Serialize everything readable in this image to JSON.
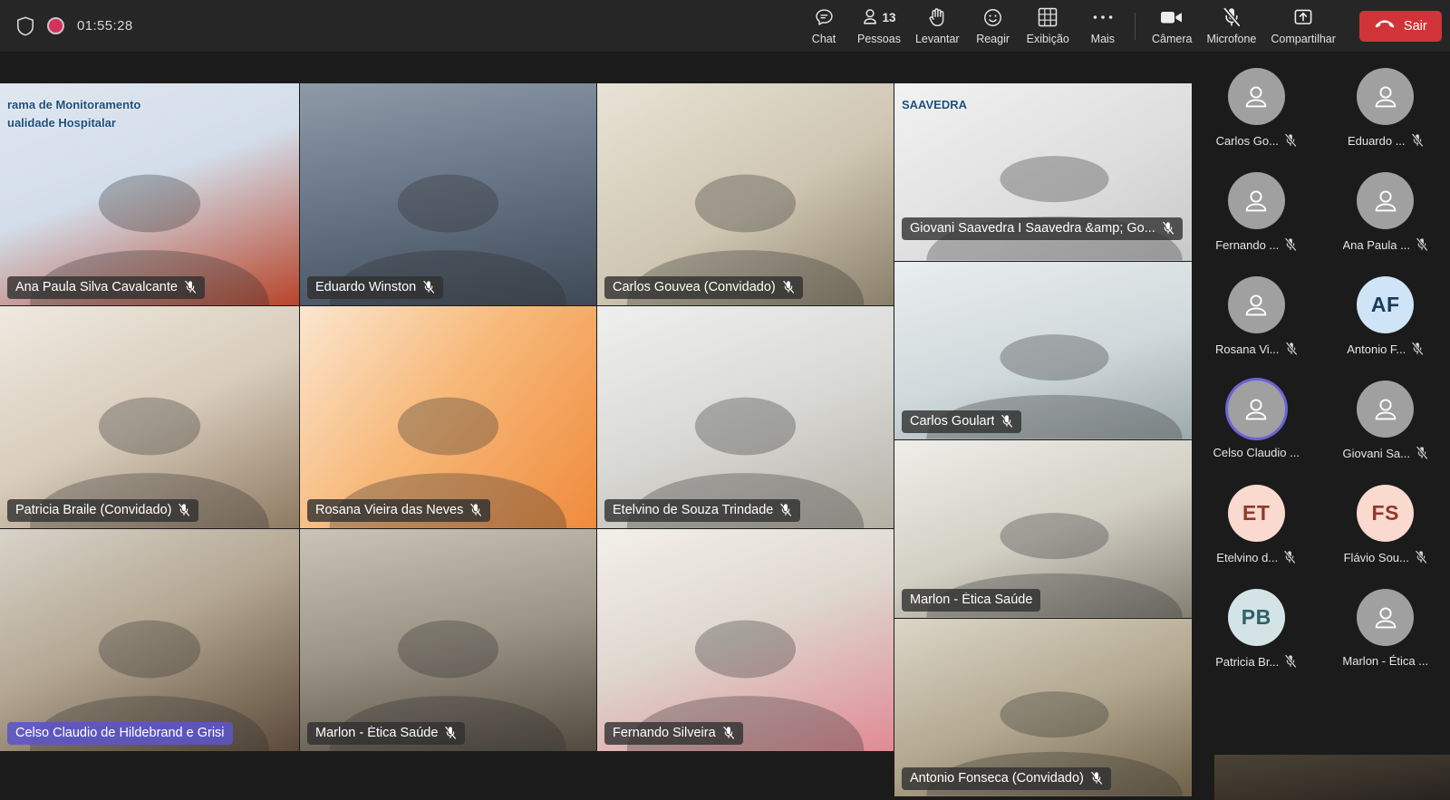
{
  "topbar": {
    "shield_icon": "shield-icon",
    "recording_icon": "record-dot-icon",
    "elapsed_time": "01:55:28",
    "buttons": [
      {
        "id": "chat",
        "label": "Chat",
        "icon": "chat-bubble-icon",
        "badge": ""
      },
      {
        "id": "people",
        "label": "Pessoas",
        "icon": "person-icon",
        "badge": "13"
      },
      {
        "id": "raise-hand",
        "label": "Levantar",
        "icon": "raised-hand-icon",
        "badge": ""
      },
      {
        "id": "react",
        "label": "Reagir",
        "icon": "smiley-icon",
        "badge": ""
      },
      {
        "id": "view",
        "label": "Exibição",
        "icon": "grid-icon",
        "badge": ""
      },
      {
        "id": "more",
        "label": "Mais",
        "icon": "ellipsis-icon",
        "badge": ""
      }
    ],
    "device_buttons": [
      {
        "id": "camera",
        "label": "Câmera",
        "icon": "camera-icon",
        "muted": false
      },
      {
        "id": "mic",
        "label": "Microfone",
        "icon": "microphone-off-icon",
        "muted": true
      },
      {
        "id": "share",
        "label": "Compartilhar",
        "icon": "share-up-arrow-icon",
        "muted": false
      }
    ],
    "leave_button": {
      "label": "Sair",
      "icon": "hangup-phone-icon",
      "color": "#d13438"
    }
  },
  "stage": {
    "tiles": [
      {
        "name": "Ana Paula Silva Cavalcante",
        "muted": true,
        "active": false,
        "tag_pos": "bottom",
        "bg": "linear-gradient(160deg,#dfe7f0 0%,#d3dde9 45%,#b8442a 100%)",
        "overlay_text": [
          "rama de Monitoramento",
          "ualidade Hospitalar"
        ]
      },
      {
        "name": "Eduardo Winston",
        "muted": true,
        "active": false,
        "tag_pos": "bottom",
        "bg": "linear-gradient(170deg,#8e9aa6 0%,#6d7b8c 40%,#3f4a57 100%)",
        "overlay_text": []
      },
      {
        "name": "Carlos Gouvea   (Convidado)",
        "muted": true,
        "active": false,
        "tag_pos": "bottom",
        "bg": "linear-gradient(150deg,#e8e3d6 0%,#cfc6b2 55%,#8a7f6a 100%)",
        "overlay_text": []
      },
      {
        "name": "Giovani Saavedra I Saavedra &amp; Go...",
        "muted": true,
        "active": false,
        "tag_pos": "top",
        "bg": "linear-gradient(150deg,#f2f2f2 0%,#dcdcdc 60%,#c6c6c6 100%)",
        "overlay_text": [
          "SAAVEDRA"
        ]
      },
      {
        "name": "Patricia Braile (Convidado)",
        "muted": true,
        "active": false,
        "tag_pos": "bottom",
        "bg": "linear-gradient(155deg,#efe9e0 0%,#d8ccbb 50%,#8e7a62 100%)",
        "overlay_text": []
      },
      {
        "name": "Rosana Vieira das Neves",
        "muted": true,
        "active": false,
        "tag_pos": "bottom",
        "bg": "linear-gradient(130deg,#fbe6cf 0%,#f7b97a 45%,#ef8b3c 100%)",
        "overlay_text": []
      },
      {
        "name": "Etelvino de Souza Trindade",
        "muted": true,
        "active": false,
        "tag_pos": "bottom",
        "bg": "linear-gradient(160deg,#efefef 0%,#d9d9d6 50%,#b4b0a4 100%)",
        "overlay_text": []
      },
      {
        "name": "Carlos Goulart",
        "muted": true,
        "active": false,
        "tag_pos": "bottom",
        "bg": "linear-gradient(165deg,#e9eef0 0%,#cfd8da 55%,#9aa6a8 100%)",
        "overlay_text": []
      },
      {
        "name": "Celso Claudio de Hildebrand e Grisi",
        "muted": false,
        "active": true,
        "tag_pos": "bottom",
        "bg": "linear-gradient(155deg,#d8d3c9 0%,#b5a894 45%,#5b4a39 100%)",
        "overlay_text": []
      },
      {
        "name": "Marlon - Ética Saúde",
        "muted": false,
        "active": false,
        "tag_pos": "bottom",
        "bg": "linear-gradient(160deg,#efeee8 0%,#d2cfc4 50%,#7e7a6e 100%)",
        "overlay_text": []
      },
      {
        "name": "Fernando Silveira",
        "muted": true,
        "active": false,
        "tag_pos": "bottom",
        "bg": "linear-gradient(160deg,#f3f0ea 0%,#ded8cf 45%,#e08a95 100%)",
        "overlay_text": []
      },
      {
        "name": "Marlon - Ética Saúde",
        "muted": true,
        "active": false,
        "tag_pos": "bottom",
        "bg": "linear-gradient(170deg,#c9c4b6 0%,#9b9486 50%,#514a3e 100%)",
        "overlay_text": []
      },
      {
        "name": "Antonio Fonseca (Convidado)",
        "muted": true,
        "active": false,
        "tag_pos": "bottom",
        "bg": "linear-gradient(160deg,#dcd6c8 0%,#b3a890 50%,#6a5c45 100%)",
        "overlay_text": []
      }
    ]
  },
  "sidebar": {
    "collapse_icon": "chevron-up-icon",
    "participants": [
      {
        "name": "Carlos Go...",
        "initials": "",
        "avatar_bg": "#a0a0a0",
        "avatar_fg": "#ffffff",
        "muted": true,
        "active": false
      },
      {
        "name": "Eduardo ...",
        "initials": "",
        "avatar_bg": "#a0a0a0",
        "avatar_fg": "#ffffff",
        "muted": true,
        "active": false
      },
      {
        "name": "Fernando ...",
        "initials": "",
        "avatar_bg": "#a0a0a0",
        "avatar_fg": "#ffffff",
        "muted": true,
        "active": false
      },
      {
        "name": "Ana Paula ...",
        "initials": "",
        "avatar_bg": "#a0a0a0",
        "avatar_fg": "#ffffff",
        "muted": true,
        "active": false
      },
      {
        "name": "Rosana Vi...",
        "initials": "",
        "avatar_bg": "#a0a0a0",
        "avatar_fg": "#ffffff",
        "muted": true,
        "active": false
      },
      {
        "name": "Antonio F...",
        "initials": "AF",
        "avatar_bg": "#cfe4f7",
        "avatar_fg": "#173a5e",
        "muted": true,
        "active": false
      },
      {
        "name": "Celso Claudio ...",
        "initials": "",
        "avatar_bg": "#a0a0a0",
        "avatar_fg": "#ffffff",
        "muted": false,
        "active": true
      },
      {
        "name": "Giovani Sa...",
        "initials": "",
        "avatar_bg": "#a0a0a0",
        "avatar_fg": "#ffffff",
        "muted": true,
        "active": false
      },
      {
        "name": "Etelvino d...",
        "initials": "ET",
        "avatar_bg": "#fad9cf",
        "avatar_fg": "#8e3b2a",
        "muted": true,
        "active": false
      },
      {
        "name": "Flávio Sou...",
        "initials": "FS",
        "avatar_bg": "#fad9cf",
        "avatar_fg": "#8e3b2a",
        "muted": true,
        "active": false
      },
      {
        "name": "Patricia Br...",
        "initials": "PB",
        "avatar_bg": "#d4e3e6",
        "avatar_fg": "#2f6067",
        "muted": true,
        "active": false
      },
      {
        "name": "Marlon - Ética ...",
        "initials": "",
        "avatar_bg": "#a0a0a0",
        "avatar_fg": "#ffffff",
        "muted": false,
        "active": false
      }
    ]
  }
}
